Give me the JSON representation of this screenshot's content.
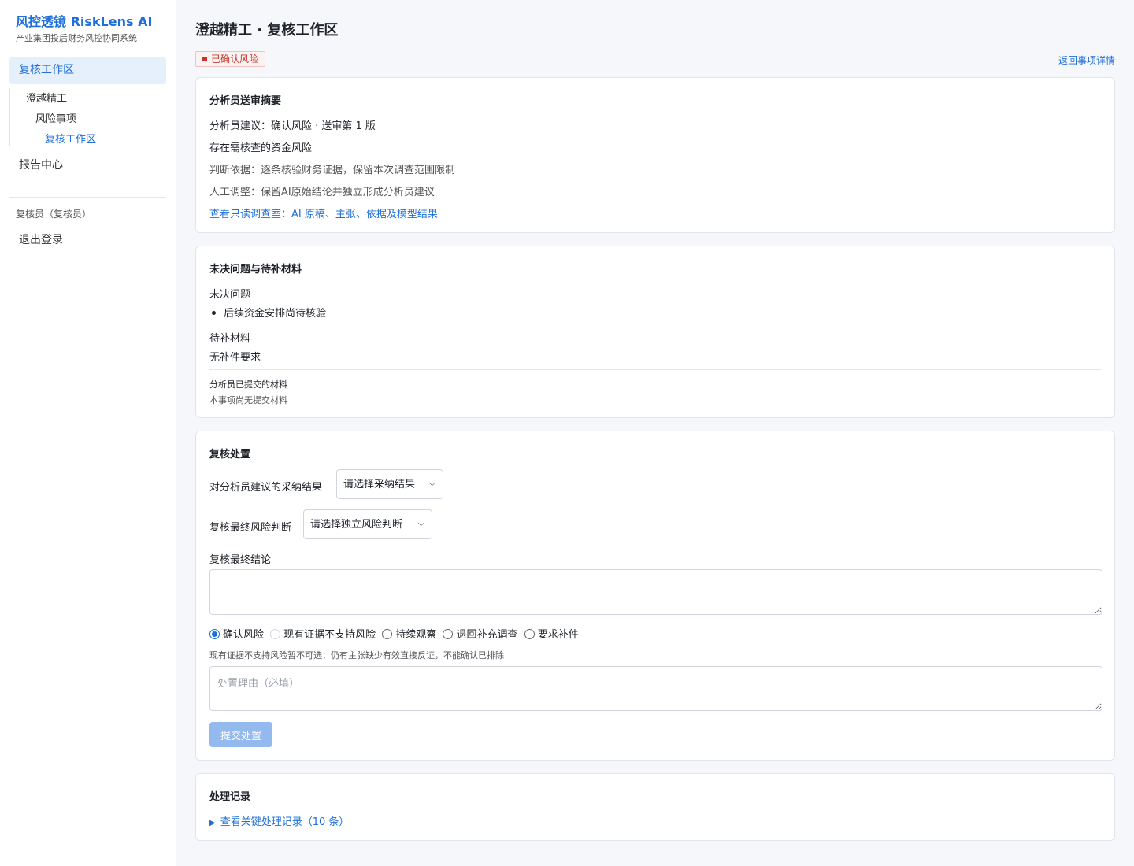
{
  "brand": {
    "title": "风控透镜 RiskLens AI",
    "subtitle": "产业集团投后财务风控协同系统"
  },
  "sidebar": {
    "active_item": "复核工作区",
    "tree": [
      "澄越精工",
      "风险事项",
      "复核工作区"
    ],
    "report_center": "报告中心",
    "user": "复核员（复核员）",
    "logout": "退出登录"
  },
  "header": {
    "title": "澄越精工 · 复核工作区",
    "status_badge": "已确认风险",
    "back_link": "返回事项详情"
  },
  "summary": {
    "title": "分析员送审摘要",
    "suggestion": "分析员建议：确认风险 · 送审第 1 版",
    "headline": "存在需核查的资金风险",
    "basis": "判断依据：逐条核验财务证据，保留本次调查范围限制",
    "adjustment": "人工调整：保留AI原始结论并独立形成分析员建议",
    "readonly_link": "查看只读调查室：AI 原稿、主张、依据及模型结果"
  },
  "issues": {
    "title": "未决问题与待补材料",
    "open_label": "未决问题",
    "open_items": [
      "后续资金安排尚待核验"
    ],
    "pending_label": "待补材料",
    "pending_value": "无补件要求",
    "submitted_label": "分析员已提交的材料",
    "submitted_value": "本事项尚无提交材料"
  },
  "disposal": {
    "title": "复核处置",
    "adopt_label": "对分析员建议的采纳结果",
    "adopt_selected": "请选择采纳结果",
    "risk_label": "复核最终风险判断",
    "risk_selected": "请选择独立风险判断",
    "conclusion_label": "复核最终结论",
    "conclusion_value": "",
    "options": [
      "确认风险",
      "现有证据不支持风险",
      "持续观察",
      "退回补充调查",
      "要求补件"
    ],
    "selected_option": "确认风险",
    "disabled_option": "现有证据不支持风险",
    "hint": "现有证据不支持风险暂不可选：仍有主张缺少有效直接反证，不能确认已排除",
    "reason_placeholder": "处置理由（必填）",
    "submit_label": "提交处置"
  },
  "records": {
    "title": "处理记录",
    "toggle_label": "查看关键处理记录（10 条）"
  },
  "colors": {
    "accent": "#1e6fd9",
    "danger": "#d32f2f",
    "submit_disabled": "#93b9ef"
  }
}
